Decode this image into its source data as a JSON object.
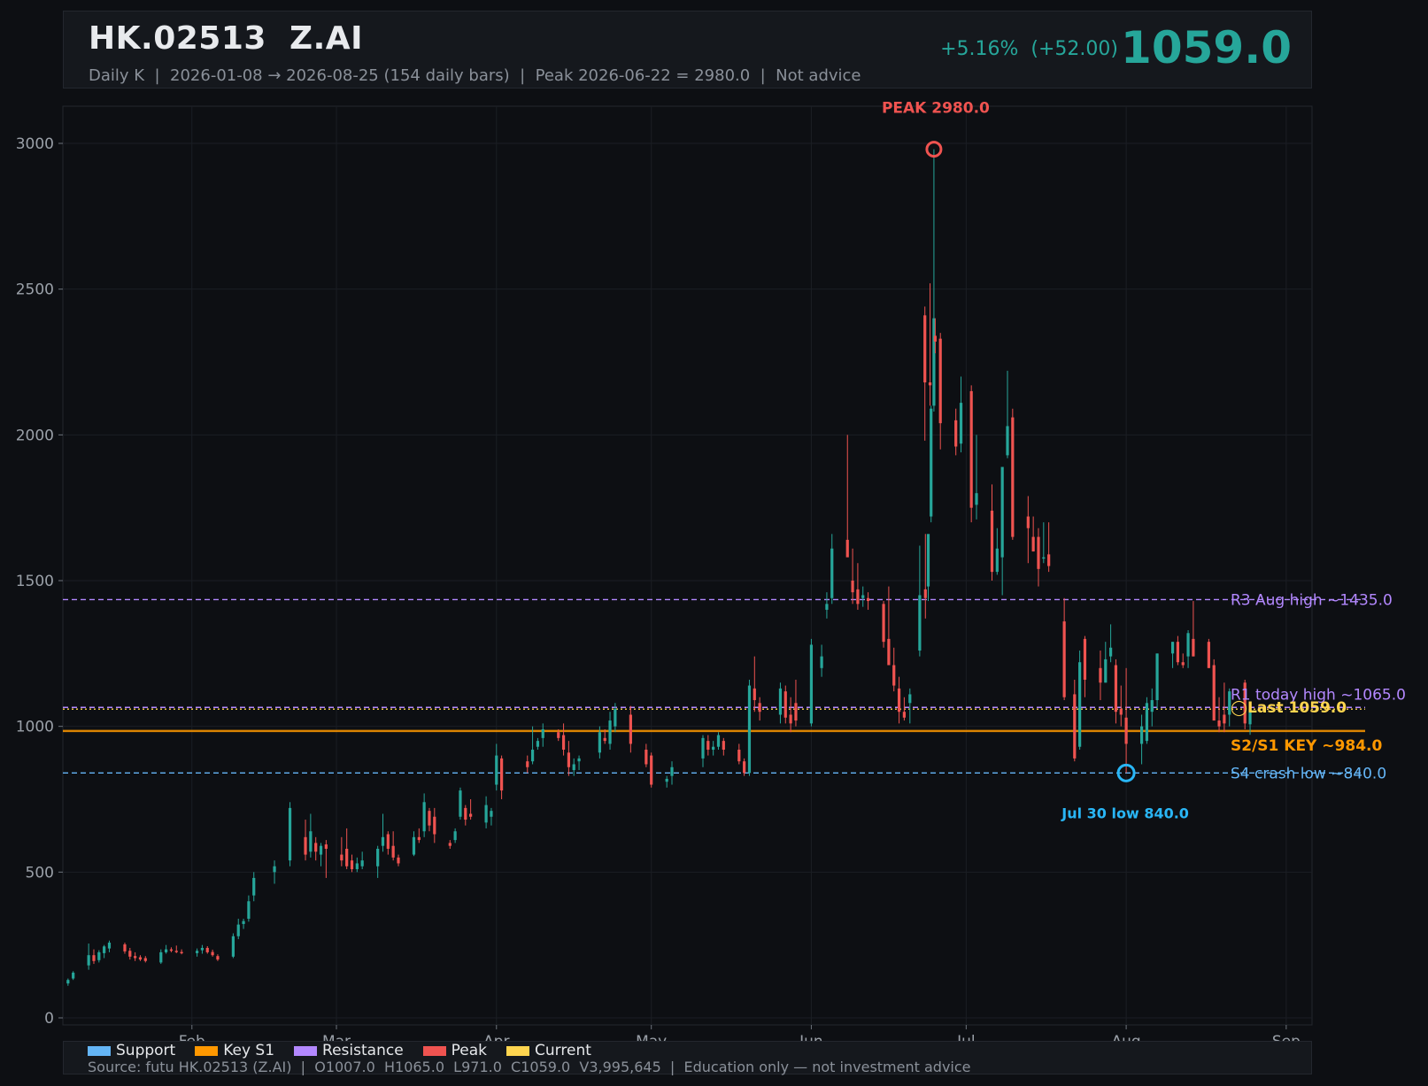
{
  "header": {
    "title": "HK.02513  Z.AI",
    "subtitle": "Daily K  |  2026-01-08 → 2026-08-25 (154 daily bars)  |  Peak 2026-06-22 = 2980.0  |  Not advice",
    "change": "+5.16%  (+52.00)",
    "price": "1059.0"
  },
  "colors": {
    "up": "#26a69a",
    "down": "#ef5350",
    "support": "#64b5f6",
    "key_s1": "#ff9800",
    "resistance": "#b388ff",
    "peak": "#ef5350",
    "current": "#ffd54f",
    "low_marker": "#29b6f6"
  },
  "chart_data": {
    "type": "candlestick",
    "ylim": [
      0,
      3100
    ],
    "yticks": [
      0,
      500,
      1000,
      1500,
      2000,
      2500,
      3000
    ],
    "xlim": [
      "2026-01-07",
      "2026-09-06"
    ],
    "xticks": [
      {
        "date": "2026-02-01",
        "label": "Feb"
      },
      {
        "date": "2026-03-01",
        "label": "Mar"
      },
      {
        "date": "2026-04-01",
        "label": "Apr"
      },
      {
        "date": "2026-05-01",
        "label": "May"
      },
      {
        "date": "2026-06-01",
        "label": "Jun"
      },
      {
        "date": "2026-07-01",
        "label": "Jul"
      },
      {
        "date": "2026-08-01",
        "label": "Aug"
      },
      {
        "date": "2026-09-01",
        "label": "Sep"
      }
    ],
    "bars": [
      [
        "2026-01-08",
        118,
        135,
        110,
        130
      ],
      [
        "2026-01-09",
        135,
        160,
        130,
        155
      ],
      [
        "2026-01-12",
        180,
        255,
        165,
        215
      ],
      [
        "2026-01-13",
        215,
        235,
        185,
        195
      ],
      [
        "2026-01-14",
        198,
        232,
        190,
        225
      ],
      [
        "2026-01-15",
        222,
        250,
        205,
        245
      ],
      [
        "2026-01-16",
        238,
        265,
        225,
        258
      ],
      [
        "2026-01-19",
        252,
        258,
        220,
        228
      ],
      [
        "2026-01-20",
        230,
        240,
        200,
        210
      ],
      [
        "2026-01-21",
        212,
        225,
        195,
        205
      ],
      [
        "2026-01-22",
        208,
        215,
        195,
        200
      ],
      [
        "2026-01-23",
        205,
        212,
        190,
        195
      ],
      [
        "2026-01-26",
        190,
        235,
        185,
        225
      ],
      [
        "2026-01-27",
        225,
        250,
        220,
        235
      ],
      [
        "2026-01-28",
        235,
        242,
        225,
        230
      ],
      [
        "2026-01-29",
        230,
        248,
        222,
        228
      ],
      [
        "2026-01-30",
        226,
        235,
        218,
        222
      ],
      [
        "2026-02-02",
        222,
        238,
        210,
        230
      ],
      [
        "2026-02-03",
        232,
        250,
        220,
        240
      ],
      [
        "2026-02-04",
        240,
        246,
        220,
        225
      ],
      [
        "2026-02-05",
        226,
        234,
        210,
        215
      ],
      [
        "2026-02-06",
        212,
        218,
        195,
        200
      ],
      [
        "2026-02-09",
        210,
        290,
        205,
        280
      ],
      [
        "2026-02-10",
        280,
        340,
        270,
        320
      ],
      [
        "2026-02-11",
        322,
        340,
        305,
        332
      ],
      [
        "2026-02-12",
        340,
        420,
        330,
        400
      ],
      [
        "2026-02-13",
        420,
        500,
        400,
        480
      ],
      [
        "2026-02-17",
        500,
        540,
        460,
        520
      ],
      [
        "2026-02-20",
        540,
        740,
        520,
        720
      ],
      [
        "2026-02-23",
        620,
        680,
        540,
        560
      ],
      [
        "2026-02-24",
        570,
        700,
        550,
        640
      ],
      [
        "2026-02-25",
        600,
        620,
        540,
        570
      ],
      [
        "2026-02-26",
        560,
        600,
        520,
        590
      ],
      [
        "2026-02-27",
        595,
        610,
        480,
        580
      ],
      [
        "2026-03-02",
        560,
        620,
        520,
        540
      ],
      [
        "2026-03-03",
        580,
        650,
        510,
        520
      ],
      [
        "2026-03-04",
        540,
        560,
        500,
        510
      ],
      [
        "2026-03-05",
        510,
        550,
        500,
        530
      ],
      [
        "2026-03-06",
        520,
        570,
        510,
        540
      ],
      [
        "2026-03-09",
        520,
        590,
        480,
        580
      ],
      [
        "2026-03-10",
        590,
        700,
        570,
        620
      ],
      [
        "2026-03-11",
        630,
        640,
        560,
        580
      ],
      [
        "2026-03-12",
        590,
        640,
        540,
        550
      ],
      [
        "2026-03-13",
        550,
        560,
        520,
        530
      ],
      [
        "2026-03-16",
        560,
        640,
        555,
        620
      ],
      [
        "2026-03-17",
        620,
        650,
        600,
        610
      ],
      [
        "2026-03-18",
        640,
        770,
        620,
        740
      ],
      [
        "2026-03-19",
        710,
        720,
        640,
        660
      ],
      [
        "2026-03-20",
        690,
        720,
        600,
        630
      ],
      [
        "2026-03-23",
        600,
        610,
        580,
        590
      ],
      [
        "2026-03-24",
        610,
        650,
        600,
        640
      ],
      [
        "2026-03-25",
        690,
        790,
        680,
        780
      ],
      [
        "2026-03-26",
        720,
        730,
        660,
        680
      ],
      [
        "2026-03-27",
        700,
        750,
        680,
        690
      ],
      [
        "2026-03-30",
        670,
        760,
        650,
        730
      ],
      [
        "2026-03-31",
        690,
        720,
        660,
        710
      ],
      [
        "2026-04-01",
        800,
        940,
        780,
        900
      ],
      [
        "2026-04-02",
        890,
        900,
        750,
        780
      ],
      [
        "2026-04-07",
        880,
        900,
        840,
        860
      ],
      [
        "2026-04-08",
        880,
        1000,
        870,
        920
      ],
      [
        "2026-04-09",
        930,
        960,
        920,
        950
      ],
      [
        "2026-04-10",
        960,
        1010,
        930,
        990
      ],
      [
        "2026-04-13",
        980,
        990,
        950,
        960
      ],
      [
        "2026-04-14",
        970,
        1010,
        900,
        920
      ],
      [
        "2026-04-15",
        910,
        950,
        830,
        860
      ],
      [
        "2026-04-16",
        850,
        890,
        830,
        870
      ],
      [
        "2026-04-17",
        880,
        900,
        850,
        890
      ],
      [
        "2026-04-21",
        910,
        1000,
        890,
        980
      ],
      [
        "2026-04-22",
        960,
        990,
        940,
        950
      ],
      [
        "2026-04-23",
        940,
        1050,
        920,
        1020
      ],
      [
        "2026-04-24",
        1000,
        1080,
        980,
        1060
      ],
      [
        "2026-04-27",
        1040,
        1070,
        910,
        940
      ],
      [
        "2026-04-30",
        920,
        940,
        860,
        870
      ],
      [
        "2026-05-01",
        900,
        910,
        790,
        800
      ],
      [
        "2026-05-04",
        810,
        830,
        790,
        820
      ],
      [
        "2026-05-05",
        830,
        880,
        800,
        860
      ],
      [
        "2026-05-11",
        890,
        970,
        860,
        960
      ],
      [
        "2026-05-12",
        950,
        970,
        900,
        920
      ],
      [
        "2026-05-13",
        920,
        950,
        900,
        930
      ],
      [
        "2026-05-14",
        930,
        980,
        920,
        970
      ],
      [
        "2026-05-15",
        950,
        960,
        900,
        920
      ],
      [
        "2026-05-18",
        920,
        940,
        870,
        880
      ],
      [
        "2026-05-19",
        880,
        890,
        830,
        840
      ],
      [
        "2026-05-20",
        840,
        1160,
        830,
        1140
      ],
      [
        "2026-05-21",
        1130,
        1240,
        1050,
        1090
      ],
      [
        "2026-05-22",
        1080,
        1100,
        1020,
        1050
      ],
      [
        "2026-05-26",
        1040,
        1150,
        1010,
        1130
      ],
      [
        "2026-05-27",
        1120,
        1140,
        1010,
        1030
      ],
      [
        "2026-05-28",
        1040,
        1100,
        980,
        1010
      ],
      [
        "2026-05-29",
        1080,
        1160,
        1000,
        1020
      ],
      [
        "2026-06-01",
        1010,
        1300,
        1000,
        1280
      ],
      [
        "2026-06-03",
        1200,
        1280,
        1170,
        1240
      ],
      [
        "2026-06-04",
        1400,
        1460,
        1370,
        1420
      ],
      [
        "2026-06-05",
        1440,
        1660,
        1420,
        1610
      ],
      [
        "2026-06-08",
        1640,
        2000,
        1620,
        1580
      ],
      [
        "2026-06-09",
        1500,
        1610,
        1420,
        1460
      ],
      [
        "2026-06-10",
        1470,
        1560,
        1400,
        1420
      ],
      [
        "2026-06-11",
        1440,
        1480,
        1410,
        1450
      ],
      [
        "2026-06-12",
        1440,
        1460,
        1400,
        1430
      ],
      [
        "2026-06-15",
        1420,
        1430,
        1270,
        1290
      ],
      [
        "2026-06-16",
        1300,
        1480,
        1240,
        1210
      ],
      [
        "2026-06-17",
        1210,
        1270,
        1120,
        1140
      ],
      [
        "2026-06-18",
        1130,
        1170,
        1010,
        1050
      ],
      [
        "2026-06-19",
        1050,
        1100,
        1020,
        1030
      ],
      [
        "2026-06-19b",
        1080,
        1130,
        1010,
        1110
      ],
      [
        "2026-06-22",
        1260,
        1620,
        1240,
        1450
      ],
      [
        "2026-06-22b",
        1470,
        1660,
        1370,
        1440
      ],
      [
        "2026-06-22c",
        1480,
        1650,
        1430,
        1660
      ],
      [
        "2026-06-22d",
        1720,
        2100,
        1700,
        2090
      ],
      [
        "2026-06-22e",
        2100,
        2980,
        2080,
        2400
      ],
      [
        "2026-06-23",
        2410,
        2440,
        1980,
        2180
      ],
      [
        "2026-06-24",
        2180,
        2520,
        2100,
        2170
      ],
      [
        "2026-06-25",
        2340,
        2400,
        2280,
        2320
      ],
      [
        "2026-06-26",
        2330,
        2350,
        1950,
        2040
      ],
      [
        "2026-06-29",
        2050,
        2090,
        1930,
        1960
      ],
      [
        "2026-06-30",
        1970,
        2200,
        1940,
        2110
      ],
      [
        "2026-07-02",
        2150,
        2170,
        1700,
        1750
      ],
      [
        "2026-07-03",
        1760,
        2000,
        1710,
        1800
      ],
      [
        "2026-07-06",
        1740,
        1830,
        1500,
        1530
      ],
      [
        "2026-07-07",
        1530,
        1680,
        1520,
        1610
      ],
      [
        "2026-07-08",
        1580,
        1830,
        1450,
        1890
      ],
      [
        "2026-07-09",
        1930,
        2220,
        1920,
        2030
      ],
      [
        "2026-07-10",
        2060,
        2090,
        1640,
        1650
      ],
      [
        "2026-07-13",
        1720,
        1790,
        1560,
        1680
      ],
      [
        "2026-07-14",
        1650,
        1720,
        1600,
        1600
      ],
      [
        "2026-07-15",
        1650,
        1680,
        1480,
        1540
      ],
      [
        "2026-07-16",
        1580,
        1700,
        1560,
        1580
      ],
      [
        "2026-07-17",
        1590,
        1700,
        1530,
        1550
      ],
      [
        "2026-07-20",
        1360,
        1440,
        1090,
        1100
      ],
      [
        "2026-07-22",
        1110,
        1160,
        880,
        890
      ],
      [
        "2026-07-23",
        930,
        1260,
        920,
        1220
      ],
      [
        "2026-07-24",
        1300,
        1310,
        1100,
        1160
      ],
      [
        "2026-07-27",
        1200,
        1260,
        1090,
        1150
      ],
      [
        "2026-07-28",
        1150,
        1290,
        1150,
        1230
      ],
      [
        "2026-07-29",
        1240,
        1350,
        1220,
        1270
      ],
      [
        "2026-07-30",
        1210,
        1230,
        1010,
        1050
      ],
      [
        "2026-07-31",
        1060,
        1140,
        1000,
        1040
      ],
      [
        "2026-08-01",
        1030,
        1200,
        840,
        940
      ],
      [
        "2026-08-04",
        940,
        1040,
        870,
        1000
      ],
      [
        "2026-08-05",
        950,
        1100,
        940,
        1080
      ],
      [
        "2026-08-06",
        1050,
        1130,
        1000,
        1090
      ],
      [
        "2026-08-07",
        1090,
        1250,
        1060,
        1250
      ],
      [
        "2026-08-10",
        1250,
        1290,
        1200,
        1290
      ],
      [
        "2026-08-11",
        1290,
        1310,
        1210,
        1220
      ],
      [
        "2026-08-12",
        1220,
        1250,
        1200,
        1210
      ],
      [
        "2026-08-13",
        1240,
        1330,
        1200,
        1320
      ],
      [
        "2026-08-14",
        1300,
        1430,
        1240,
        1240
      ],
      [
        "2026-08-17",
        1290,
        1300,
        1200,
        1200
      ],
      [
        "2026-08-18",
        1210,
        1230,
        1030,
        1020
      ],
      [
        "2026-08-19",
        1020,
        1100,
        980,
        1000
      ],
      [
        "2026-08-20",
        1040,
        1150,
        980,
        1010
      ],
      [
        "2026-08-21",
        1040,
        1130,
        1000,
        1120
      ],
      [
        "2026-08-24",
        1150,
        1160,
        990,
        1010
      ],
      [
        "2026-08-25",
        1007,
        1065,
        971,
        1059
      ]
    ],
    "levels": [
      {
        "name": "R3",
        "value": 1435,
        "label": "R3 Aug high ~1435.0",
        "kind": "resistance",
        "style": "dashed"
      },
      {
        "name": "R1",
        "value": 1065,
        "label": "R1 today high ~1065.0",
        "kind": "resistance",
        "style": "dashed"
      },
      {
        "name": "Last",
        "value": 1059,
        "label": "◯Last 1059.0",
        "kind": "current",
        "style": "dotted"
      },
      {
        "name": "S2/S1",
        "value": 984,
        "label": "S2/S1 KEY ~984.0",
        "kind": "key_s1",
        "style": "solid"
      },
      {
        "name": "S4",
        "value": 840,
        "label": "S4 crash low ~840.0",
        "kind": "support",
        "style": "dashed"
      }
    ],
    "annotations": {
      "peak": {
        "date": "2026-06-22e",
        "value": 2980,
        "label": "PEAK 2980.0"
      },
      "low": {
        "date": "2026-08-01",
        "value": 840,
        "label": "Jul 30 low 840.0"
      }
    },
    "legend": [
      {
        "label": "Support",
        "kind": "support"
      },
      {
        "label": "Key S1",
        "kind": "key_s1"
      },
      {
        "label": "Resistance",
        "kind": "resistance"
      },
      {
        "label": "Peak",
        "kind": "peak"
      },
      {
        "label": "Current",
        "kind": "current"
      }
    ],
    "grid": true
  },
  "footer": {
    "source": "Source: futu HK.02513 (Z.AI)  |  O1007.0  H1065.0  L971.0  C1059.0  V3,995,645  |  Education only — not investment advice"
  }
}
